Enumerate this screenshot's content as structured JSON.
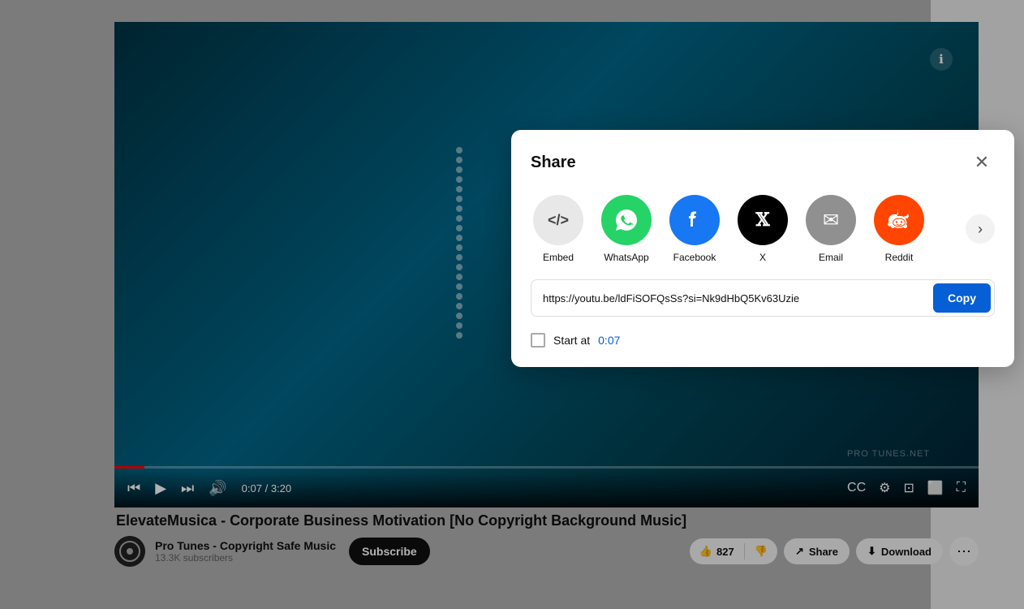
{
  "page": {
    "background": "#b0b0b0"
  },
  "video": {
    "title": "ElevateMusica - Corporate Business Motivation [No Copyright Background Music]",
    "time_current": "0:07",
    "time_total": "3:20",
    "info_icon": "ℹ",
    "watermark": "PRO TUNES.NET"
  },
  "channel": {
    "name": "Pro Tunes - Copyright Safe Music",
    "subscribers": "13.3K subscribers",
    "subscribe_label": "Subscribe"
  },
  "actions": {
    "like_count": "827",
    "like_icon": "👍",
    "dislike_icon": "👎",
    "share_label": "Share",
    "share_icon": "↗",
    "download_label": "Download",
    "download_icon": "⬇",
    "more_icon": "⋯"
  },
  "controls": {
    "skip_back": "⏮",
    "play": "▶",
    "skip_fwd": "⏭",
    "volume": "🔊",
    "cc": "CC",
    "settings": "⚙",
    "miniplayer": "⊡",
    "theater": "⬜",
    "fullscreen": "⛶"
  },
  "share_modal": {
    "title": "Share",
    "close_icon": "✕",
    "icons": [
      {
        "id": "embed",
        "label": "Embed",
        "symbol": "</>",
        "class": "icon-embed"
      },
      {
        "id": "whatsapp",
        "label": "WhatsApp",
        "symbol": "W",
        "class": "icon-whatsapp"
      },
      {
        "id": "facebook",
        "label": "Facebook",
        "symbol": "f",
        "class": "icon-facebook"
      },
      {
        "id": "x",
        "label": "X",
        "symbol": "𝕏",
        "class": "icon-x"
      },
      {
        "id": "email",
        "label": "Email",
        "symbol": "✉",
        "class": "icon-email"
      },
      {
        "id": "reddit",
        "label": "Reddit",
        "symbol": "👽",
        "class": "icon-reddit"
      }
    ],
    "next_icon": "›",
    "url": "https://youtu.be/ldFiSOFQsSs?si=Nk9dHbQ5Kv63Uzie",
    "copy_label": "Copy",
    "start_at_label": "Start at",
    "start_at_time": "0:07",
    "start_at_checked": false
  }
}
